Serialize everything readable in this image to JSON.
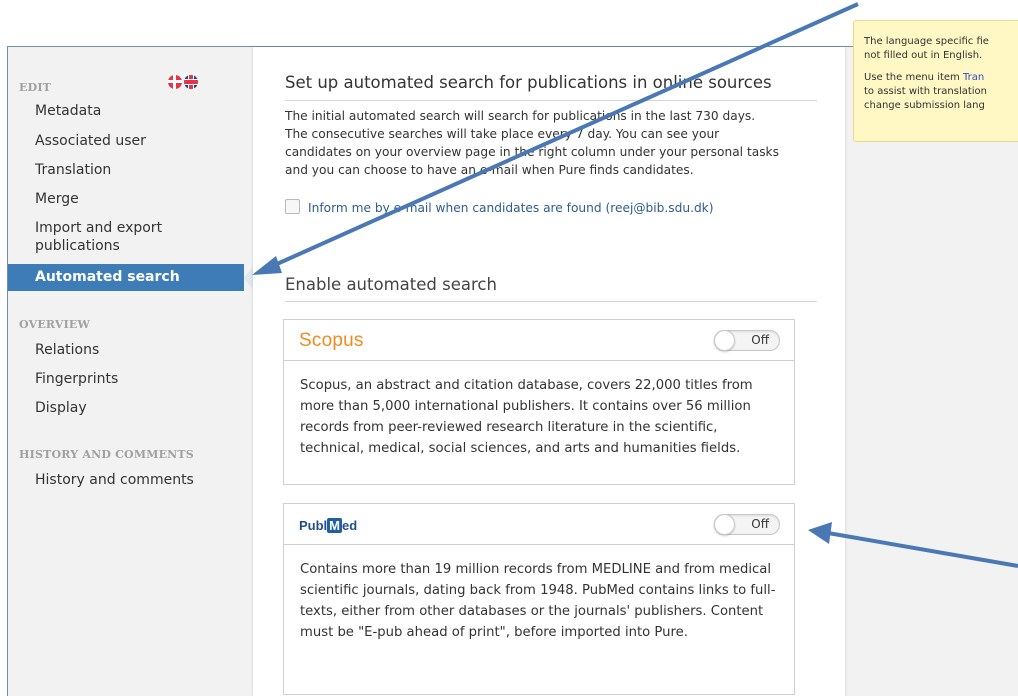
{
  "sidebar": {
    "edit_heading": "EDIT",
    "edit_items": [
      "Metadata",
      "Associated user",
      "Translation",
      "Merge",
      "Import and export publications",
      "Automated search"
    ],
    "overview_heading": "OVERVIEW",
    "overview_items": [
      "Relations",
      "Fingerprints",
      "Display"
    ],
    "history_heading": "HISTORY AND COMMENTS",
    "history_items": [
      "History and comments"
    ],
    "active_item": "Automated search"
  },
  "main": {
    "title": "Set up automated search for publications in online sources",
    "description": [
      "The initial automated search will search for publications in the last 730 days.",
      "The consecutive searches will take place every 7 day. You can see your",
      "candidates on your overview page in the right column under your personal tasks",
      "and you can choose to have an e-mail when Pure finds candidates."
    ],
    "email_checkbox_label": "Inform me by e-mail when candidates are found (reej@bib.sdu.dk)",
    "email_checkbox_checked": false,
    "enable_title": "Enable automated search",
    "sources": [
      {
        "name": "Scopus",
        "toggle_label": "Off",
        "description": "Scopus, an abstract and citation database, covers 22,000 titles from more than 5,000 international publishers. It contains over 56 million records from peer-reviewed research literature in the scientific, technical, medical, social sciences, and arts and humanities fields."
      },
      {
        "name_left": "Publ",
        "name_m": "M",
        "name_right": "ed",
        "toggle_label": "Off",
        "description": "Contains more than 19 million records from MEDLINE and from medical scientific journals, dating back from 1948. PubMed contains links to full-texts, either from other databases or the journals' publishers. Content must be \"E-pub ahead of print\", before imported into Pure."
      }
    ]
  },
  "info_box": {
    "line1": "The language specific fie",
    "line2": "not filled out in English.",
    "line3_prefix": "Use the menu item ",
    "line3_link": "Tran",
    "line4": "to assist with translation",
    "line5": "change submission lang"
  },
  "colors": {
    "active_bg": "#3e7cb7",
    "scopus_orange": "#f08c1e",
    "pubmed_blue": "#1f5fa3",
    "info_bg": "#fff7c4",
    "arrow": "#4a78b5"
  }
}
